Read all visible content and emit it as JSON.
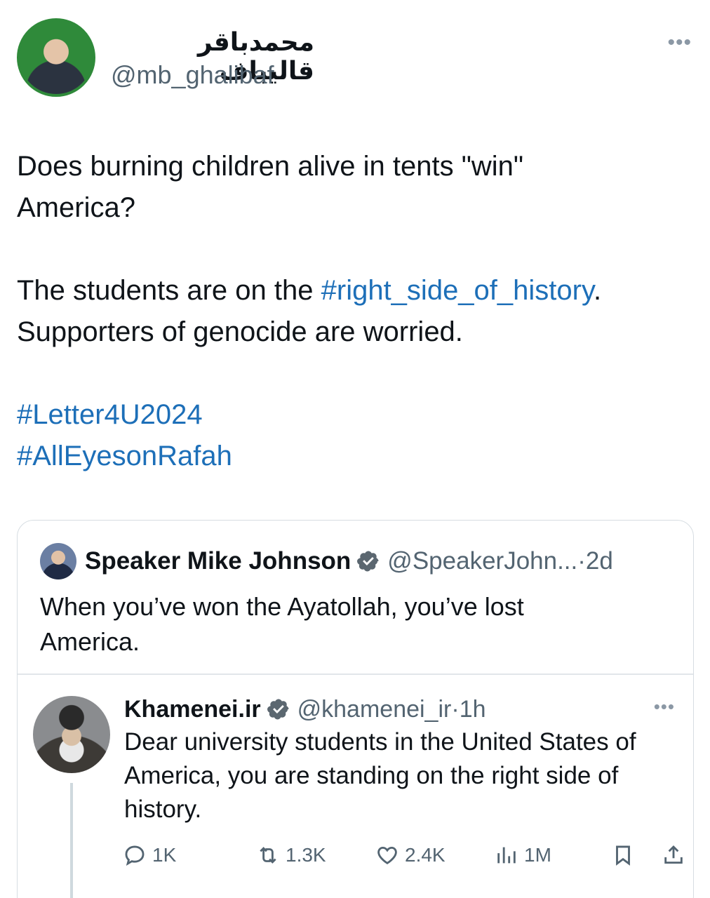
{
  "tweet": {
    "author_name": "محمدباقر قالیباف",
    "author_handle": "@mb_ghalibaf",
    "more_icon": "more-dots-icon",
    "text_lines": [
      "Does burning children alive in tents \"win\"",
      "America?"
    ],
    "para2_before": "The students are on the ",
    "para2_tag": "#right_side_of_history",
    "para2_after": ".",
    "para2_line2": "Supporters of genocide are worried.",
    "hashtags": [
      "#Letter4U2024",
      "#AllEyesonRafah"
    ]
  },
  "quote": {
    "name": "Speaker Mike Johnson",
    "handle": "@SpeakerJohn...",
    "dot": "·",
    "time": "2d",
    "text_line1": "When you’ve won the Ayatollah, you’ve lost",
    "text_line2": "America."
  },
  "nested": {
    "name": "Khamenei.ir",
    "handle": "@khamenei_ir",
    "dot": "·",
    "time": "1h",
    "text_line1": "Dear university students in the United States of",
    "text_line2": "America, you are standing on the right side of",
    "text_line3": "history.",
    "actions": {
      "reply_count": "1K",
      "retweet_count": "1.3K",
      "like_count": "2.4K",
      "views_count": "1M"
    }
  },
  "colors": {
    "link": "#1d6fb8",
    "secondary_text": "#536471",
    "verified_badge": "#5b6770"
  }
}
